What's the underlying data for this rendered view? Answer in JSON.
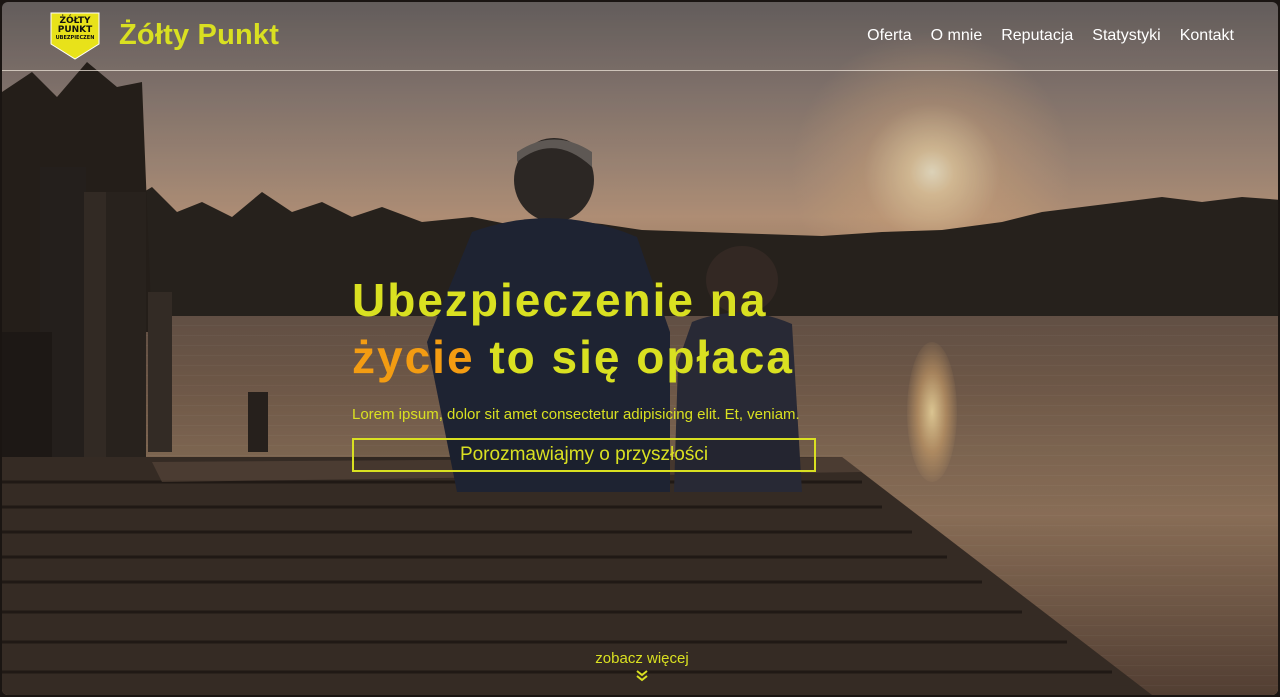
{
  "brand": {
    "name": "Żółty Punkt",
    "logo_lines": [
      "ŻÓŁTY",
      "PUNKT",
      "UBEZPIECZEN"
    ]
  },
  "nav": {
    "items": [
      {
        "label": "Oferta"
      },
      {
        "label": "O mnie"
      },
      {
        "label": "Reputacja"
      },
      {
        "label": "Statystyki"
      },
      {
        "label": "Kontakt"
      }
    ]
  },
  "hero": {
    "title_line1": "Ubezpieczenie na",
    "title_accent": "życie",
    "title_line2_rest": "to się opłaca",
    "subtitle": "Lorem ipsum, dolor sit amet consectetur adipisicing elit. Et, veniam.",
    "cta_label": "Porozmawiajmy o przyszłości"
  },
  "scroll_hint": {
    "label": "zobacz więcej",
    "icon": "double-chevron-down-icon"
  },
  "colors": {
    "brand_yellow": "#d9e021",
    "accent_orange": "#f39c12",
    "nav_text": "#ffffff"
  }
}
